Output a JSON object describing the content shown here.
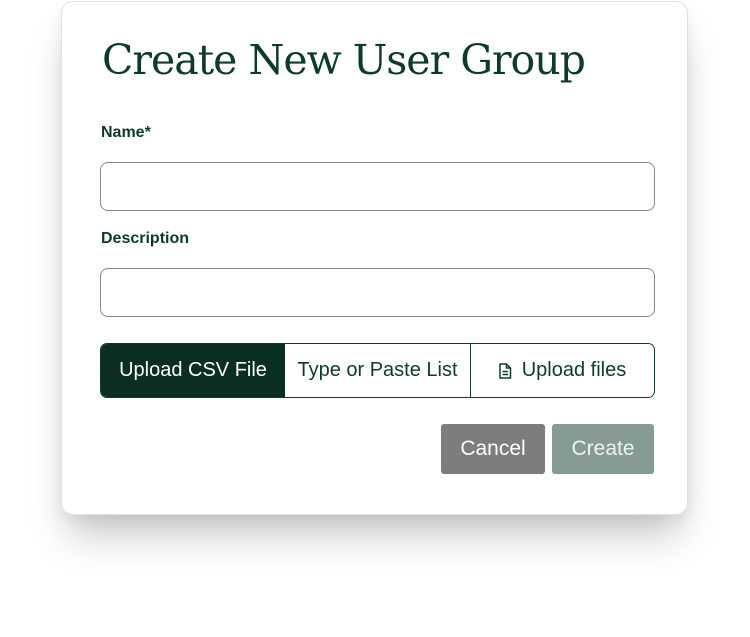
{
  "dialog": {
    "title": "Create New User Group",
    "name_label": "Name*",
    "name_value": "",
    "description_label": "Description",
    "description_value": ""
  },
  "source_tabs": {
    "items": [
      {
        "label": "Upload CSV File",
        "selected": true
      },
      {
        "label": "Type or Paste List",
        "selected": false
      },
      {
        "label": "Upload files",
        "icon": "file-icon",
        "selected": false
      }
    ]
  },
  "actions": {
    "cancel_label": "Cancel",
    "create_label": "Create",
    "create_disabled": true
  },
  "colors": {
    "primary": "#0f3a2a",
    "cancel_bg": "#7d7d7d",
    "create_bg_disabled": "#869b93"
  }
}
